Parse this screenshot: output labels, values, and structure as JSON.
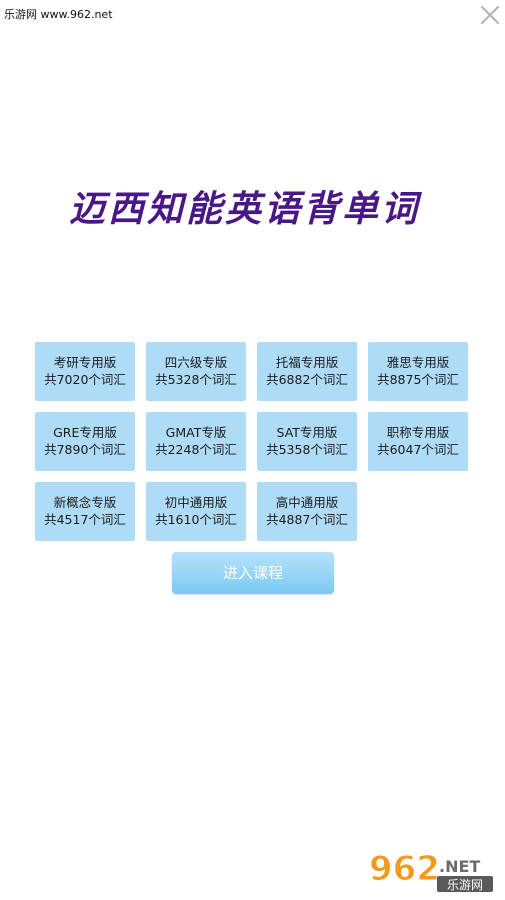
{
  "watermark_top": "乐游网 www.962.net",
  "app_title": "迈西知能英语背单词",
  "versions": [
    {
      "name": "考研专用版",
      "count": "共7020个词汇"
    },
    {
      "name": "四六级专版",
      "count": "共5328个词汇"
    },
    {
      "name": "托福专用版",
      "count": "共6882个词汇"
    },
    {
      "name": "雅思专用版",
      "count": "共8875个词汇"
    },
    {
      "name": "GRE专用版",
      "count": "共7890个词汇"
    },
    {
      "name": "GMAT专版",
      "count": "共2248个词汇"
    },
    {
      "name": "SAT专用版",
      "count": "共5358个词汇"
    },
    {
      "name": "职称专用版",
      "count": "共6047个词汇"
    },
    {
      "name": "新概念专版",
      "count": "共4517个词汇"
    },
    {
      "name": "初中通用版",
      "count": "共1610个词汇"
    },
    {
      "name": "高中通用版",
      "count": "共4887个词汇"
    }
  ],
  "enter_button": "进入课程",
  "logo": {
    "digits": "962",
    "suffix": ".NET",
    "site": "乐游网"
  },
  "icons": {
    "close": "close-icon"
  },
  "colors": {
    "title": "#4a1787",
    "button_bg": "#aedcf6",
    "enter_bg": "#7cc9f2",
    "logo_orange": "#f39a1e"
  }
}
